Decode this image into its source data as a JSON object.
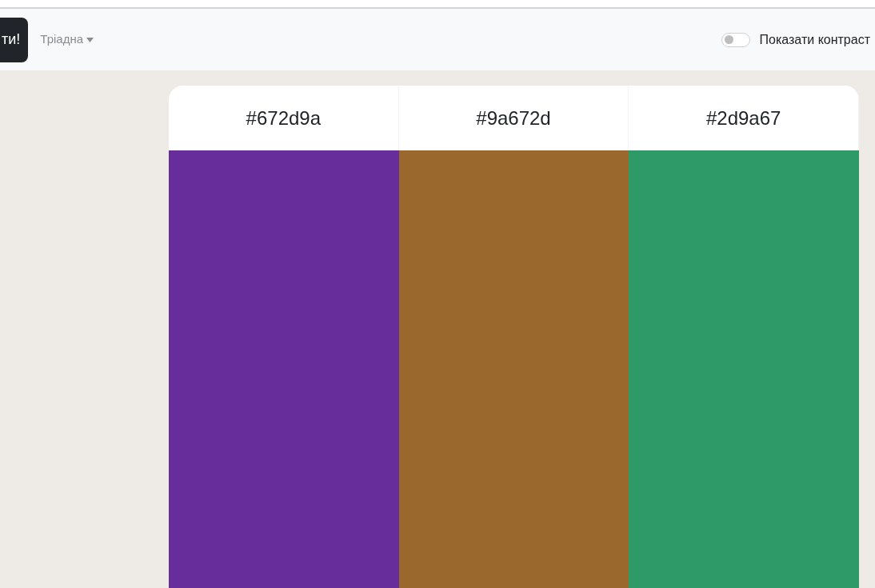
{
  "navbar": {
    "button": "ти!",
    "scheme_dropdown": "Тріадна",
    "contrast_toggle": {
      "label": "Показати контраст",
      "on": false
    }
  },
  "palette": [
    {
      "hex": "#672d9a",
      "color": "#672d9a"
    },
    {
      "hex": "#9a672d",
      "color": "#9a672d"
    },
    {
      "hex": "#2d9a67",
      "color": "#2d9a67"
    }
  ]
}
